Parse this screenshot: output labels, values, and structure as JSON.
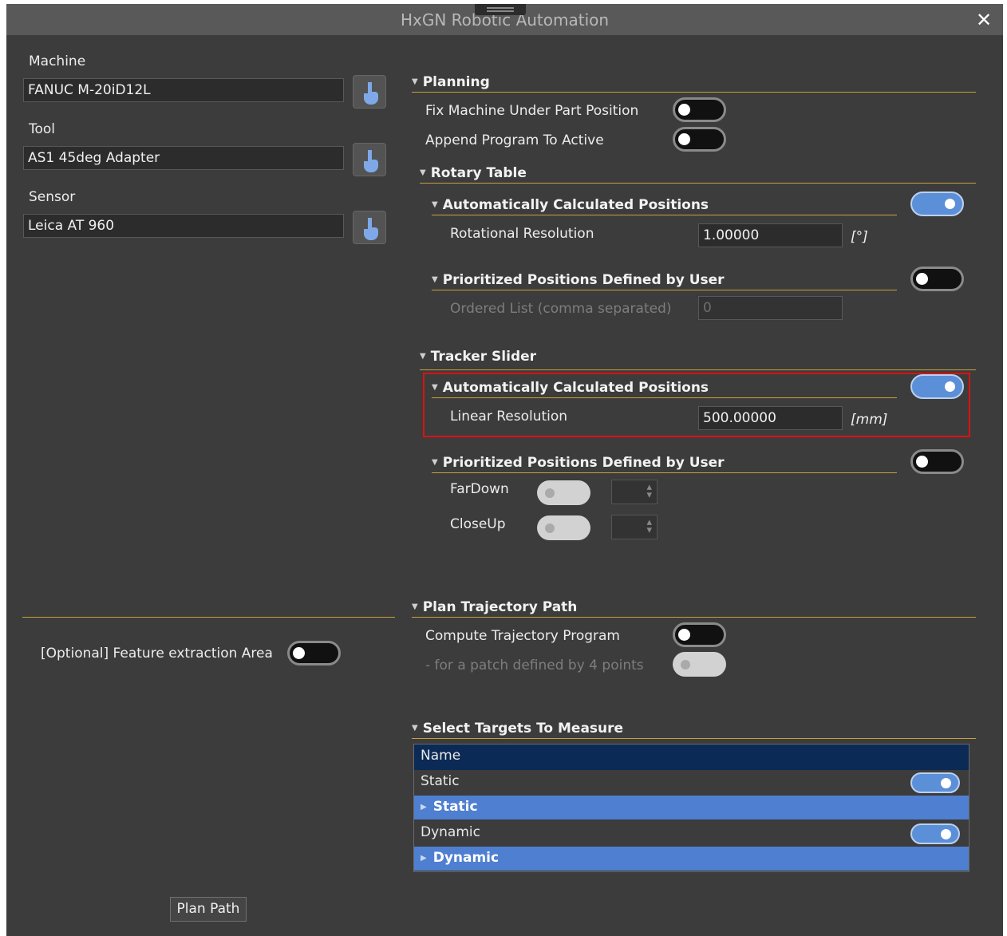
{
  "window": {
    "title": "HxGN Robotic Automation"
  },
  "left": {
    "machine": {
      "label": "Machine",
      "value": "FANUC M-20iD12L"
    },
    "tool": {
      "label": "Tool",
      "value": "AS1 45deg Adapter"
    },
    "sensor": {
      "label": "Sensor",
      "value": "Leica AT 960"
    },
    "feature_area": {
      "label": "[Optional] Feature extraction Area",
      "on": false
    },
    "plan_button": "Plan Path"
  },
  "planning": {
    "header": "Planning",
    "fix_machine": {
      "label": "Fix Machine Under Part Position",
      "on": false
    },
    "append_program": {
      "label": "Append Program To Active",
      "on": false
    },
    "rotary_table": {
      "header": "Rotary Table",
      "auto": {
        "header": "Automatically Calculated Positions",
        "on": true,
        "resolution_label": "Rotational Resolution",
        "resolution_value": "1.00000",
        "unit": "[°]"
      },
      "user": {
        "header": "Prioritized Positions Defined by User",
        "on": false,
        "list_label": "Ordered List (comma separated)",
        "list_value": "0"
      }
    },
    "tracker_slider": {
      "header": "Tracker Slider",
      "auto": {
        "header": "Automatically Calculated Positions",
        "on": true,
        "resolution_label": "Linear Resolution",
        "resolution_value": "500.00000",
        "unit": "[mm]"
      },
      "user": {
        "header": "Prioritized Positions Defined by User",
        "on": false,
        "items": [
          {
            "label": "FarDown"
          },
          {
            "label": "CloseUp"
          }
        ]
      }
    }
  },
  "trajectory": {
    "header": "Plan Trajectory Path",
    "compute": {
      "label": "Compute Trajectory Program",
      "on": false
    },
    "patch": {
      "label": "- for a patch defined by 4 points"
    }
  },
  "targets": {
    "header": "Select Targets To Measure",
    "column": "Name",
    "rows": [
      {
        "label": "Static",
        "group": "Static",
        "on": true
      },
      {
        "label": "Dynamic",
        "group": "Dynamic",
        "on": true
      }
    ]
  },
  "colors": {
    "accent_gold": "#c9a13b",
    "toggle_on": "#5b8fd8",
    "table_header": "#0b2a55",
    "group_row": "#4f7fd0",
    "highlight": "#e01010"
  }
}
